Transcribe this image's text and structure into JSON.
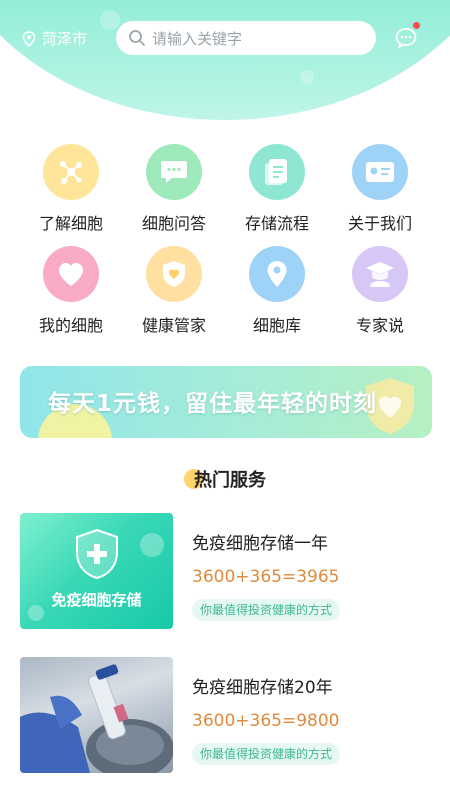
{
  "header": {
    "city": "菏泽市",
    "search_placeholder": "请输入关键字",
    "message_icon": "chat-bubble-icon"
  },
  "menu": [
    {
      "label": "了解细胞",
      "icon": "molecule-icon",
      "color": "#ffe59a"
    },
    {
      "label": "细胞问答",
      "icon": "chat-icon",
      "color": "#9ee9b9"
    },
    {
      "label": "存储流程",
      "icon": "document-icon",
      "color": "#8fe6d2"
    },
    {
      "label": "关于我们",
      "icon": "id-card-icon",
      "color": "#9fd2f7"
    },
    {
      "label": "我的细胞",
      "icon": "heart-icon",
      "color": "#f8aac7"
    },
    {
      "label": "健康管家",
      "icon": "shield-icon",
      "color": "#ffe0a0"
    },
    {
      "label": "细胞库",
      "icon": "location-pin-icon",
      "color": "#9fd2f7"
    },
    {
      "label": "专家说",
      "icon": "graduate-icon",
      "color": "#d6c7f7"
    }
  ],
  "banner": {
    "text": "每天1元钱，留住最年轻的时刻"
  },
  "section": {
    "title": "热门服务"
  },
  "services": [
    {
      "title": "免疫细胞存储一年",
      "price": "3600+365=3965",
      "tag": "你最值得投资健康的方式",
      "image_text": "免疫细胞存储"
    },
    {
      "title": "免疫细胞存储20年",
      "price": "3600+365=9800",
      "tag": "你最值得投资健康的方式"
    }
  ]
}
